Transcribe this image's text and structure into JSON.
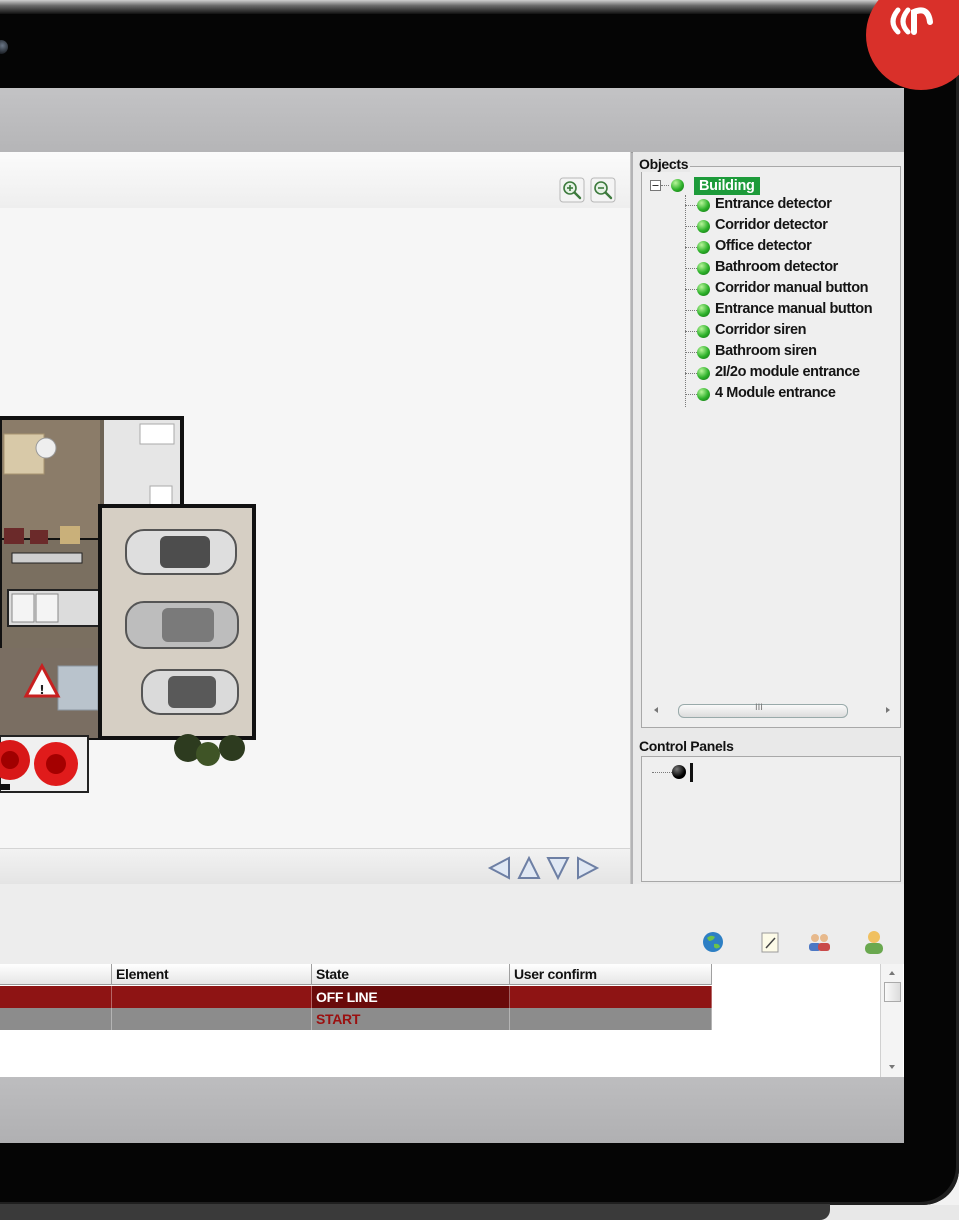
{
  "objects_panel": {
    "title": "Objects",
    "root": {
      "label": "Building",
      "status_color": "#2db12a",
      "highlight_color": "#1d9b3a"
    },
    "items": [
      {
        "label": "Entrance detector"
      },
      {
        "label": "Corridor detector"
      },
      {
        "label": "Office detector"
      },
      {
        "label": "Bathroom detector"
      },
      {
        "label": "Corridor manual button"
      },
      {
        "label": "Entrance manual button"
      },
      {
        "label": "Corridor siren"
      },
      {
        "label": "Bathroom siren"
      },
      {
        "label": "2I/2o module entrance"
      },
      {
        "label": "4 Module entrance"
      }
    ],
    "scroll_thumb_label": "III"
  },
  "control_panels": {
    "title": "Control Panels"
  },
  "map": {
    "zoom_in_icon": "zoom-in-icon",
    "zoom_out_icon": "zoom-out-icon",
    "nav_icons": [
      "arrow-left-icon",
      "arrow-up-icon",
      "arrow-down-icon",
      "arrow-right-icon"
    ]
  },
  "events": {
    "toolbar_icons": [
      "globe-icon",
      "edit-note-icon",
      "users-icon",
      "user-icon"
    ],
    "columns": [
      "Element",
      "State",
      "User confirm"
    ],
    "rows": [
      {
        "element": "",
        "state": "OFF LINE",
        "user_confirm": "",
        "row_color": "#8e1414",
        "text_color": "#ffffff"
      },
      {
        "element": "",
        "state": "START",
        "user_confirm": "",
        "row_color": "#8c8c8c",
        "text_color": "#9a1010"
      }
    ]
  },
  "colors": {
    "brand_red": "#d9302a",
    "status_green": "#2db12a",
    "alarm_red": "#8e1414"
  }
}
